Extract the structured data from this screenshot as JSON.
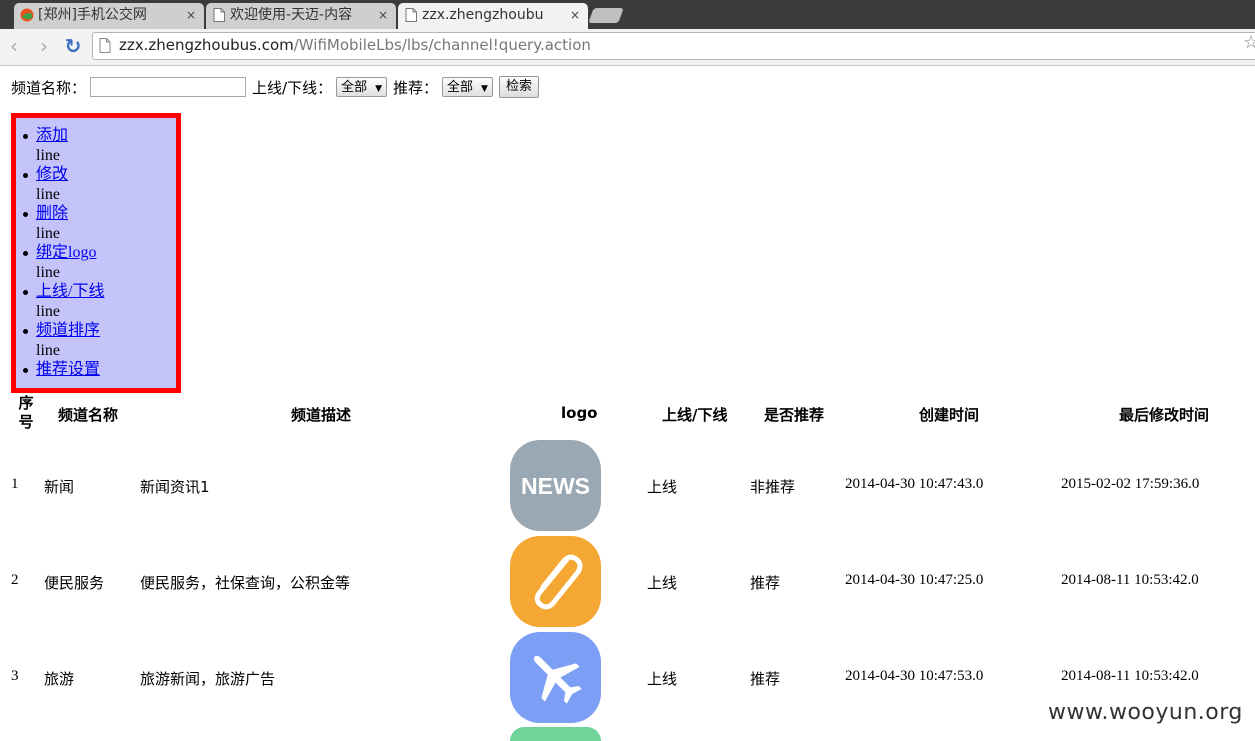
{
  "browser": {
    "tabs": [
      {
        "title": "[郑州]手机公交网",
        "close": "×",
        "active": false
      },
      {
        "title": "欢迎使用-天迈-内容管",
        "close": "×",
        "active": false
      },
      {
        "title": "zzx.zhengzhoubus.c",
        "close": "×",
        "active": true
      }
    ],
    "url_host": "zzx.zhengzhoubus.com",
    "url_path": "/WifiMobileLbs/lbs/channel!query.action",
    "back_icon": "‹",
    "forward_icon": "›",
    "reload_icon": "↻",
    "star_icon": "☆"
  },
  "search": {
    "name_label": "频道名称：",
    "name_value": "",
    "online_label": "上线/下线：",
    "online_selected": "全部",
    "recommend_label": "推荐：",
    "recommend_selected": "全部",
    "search_button": "检索"
  },
  "menu": {
    "items": [
      {
        "label": "添加",
        "link": true
      },
      {
        "label": "line",
        "link": false
      },
      {
        "label": "修改",
        "link": true
      },
      {
        "label": "line",
        "link": false
      },
      {
        "label": "删除",
        "link": true
      },
      {
        "label": "line",
        "link": false
      },
      {
        "label": "绑定logo",
        "link": true
      },
      {
        "label": "line",
        "link": false
      },
      {
        "label": "上线/下线",
        "link": true
      },
      {
        "label": "line",
        "link": false
      },
      {
        "label": "频道排序",
        "link": true
      },
      {
        "label": "line",
        "link": false
      },
      {
        "label": "推荐设置",
        "link": true
      }
    ]
  },
  "table": {
    "headers": {
      "seq": "序号",
      "name": "频道名称",
      "desc": "频道描述",
      "logo": "logo",
      "online": "上线/下线",
      "recommend": "是否推荐",
      "created": "创建时间",
      "modified": "最后修改时间"
    },
    "rows": [
      {
        "seq": "1",
        "name": "新闻",
        "desc": "新闻资讯1",
        "logo_text": "NEWS",
        "logo_color": "#9aa8b4",
        "online": "上线",
        "recommend": "非推荐",
        "created": "2014-04-30 10:47:43.0",
        "modified": "2015-02-02 17:59:36.0"
      },
      {
        "seq": "2",
        "name": "便民服务",
        "desc": "便民服务，社保查询，公积金等",
        "logo_text": "",
        "logo_color": "#f5a733",
        "online": "上线",
        "recommend": "推荐",
        "created": "2014-04-30 10:47:25.0",
        "modified": "2014-08-11 10:53:42.0"
      },
      {
        "seq": "3",
        "name": "旅游",
        "desc": "旅游新闻，旅游广告",
        "logo_text": "",
        "logo_color": "#7d9ef5",
        "online": "上线",
        "recommend": "推荐",
        "created": "2014-04-30 10:47:53.0",
        "modified": "2014-08-11 10:53:42.0"
      }
    ],
    "partial_logo_color": "#6fd39a"
  },
  "watermark": "www.wooyun.org"
}
